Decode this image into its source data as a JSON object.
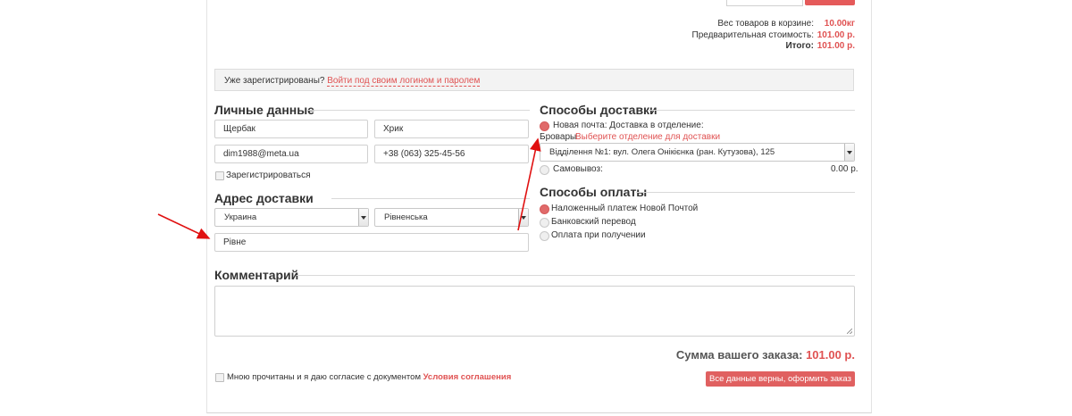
{
  "summary": {
    "weight_label": "Вес товаров в корзине:",
    "weight_value": "10.00кг",
    "pre_label": "Предварительная стоимость:",
    "pre_value": "101.00 р.",
    "total_label": "Итого:",
    "total_value": "101.00 р."
  },
  "notice": {
    "text": "Уже зарегистрированы?",
    "link": "Войти под своим логином и паролем"
  },
  "personal": {
    "title": "Личные данные",
    "last_name": "Щербак",
    "first_name": "Хрик",
    "email": "dim1988@meta.ua",
    "phone": "+38 (063) 325-45-56",
    "register_label": "Зарегистрироваться"
  },
  "address": {
    "title": "Адрес доставки",
    "country": "Украина",
    "region": "Рівненська",
    "city": "Рівне"
  },
  "delivery": {
    "title": "Способы доставки",
    "option1_label": "Новая почта: Доставка в отделение:",
    "option1_city": "Бровары",
    "option1_link": "Выберите отделение для доставки",
    "branch": "Відділення №1: вул. Олега Онікієнка (ран. Кутузова), 125",
    "option2_label": "Самовывоз:",
    "option2_price": "0.00 р."
  },
  "payment": {
    "title": "Способы оплаты",
    "options": [
      "Наложенный платеж Новой Почтой",
      "Банковский перевод",
      "Оплата при получении"
    ]
  },
  "comment": {
    "title": "Комментарий",
    "value": ""
  },
  "order": {
    "sum_label": "Сумма вашего заказа:",
    "sum_value": "101.00 р.",
    "agree_text": "Мною прочитаны и я даю согласие с документом",
    "agree_link": "Условия соглашения",
    "submit_label": "Все данные верны, оформить заказ"
  },
  "colors": {
    "accent": "#e05252"
  }
}
